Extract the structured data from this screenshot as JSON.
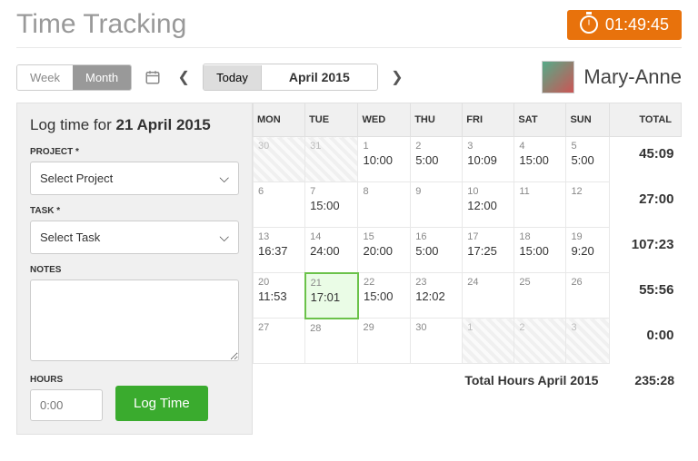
{
  "page_title": "Time Tracking",
  "timer": "01:49:45",
  "view_toggle": {
    "week": "Week",
    "month": "Month",
    "active": "month"
  },
  "today_label": "Today",
  "current_period": "April 2015",
  "user": {
    "name": "Mary-Anne"
  },
  "sidebar": {
    "title_prefix": "Log time for ",
    "title_date": "21 April 2015",
    "project_label": "PROJECT *",
    "project_placeholder": "Select Project",
    "task_label": "TASK *",
    "task_placeholder": "Select Task",
    "notes_label": "NOTES",
    "hours_label": "HOURS",
    "hours_placeholder": "0:00",
    "log_button": "Log Time"
  },
  "calendar": {
    "day_headers": [
      "MON",
      "TUE",
      "WED",
      "THU",
      "FRI",
      "SAT",
      "SUN",
      "TOTAL"
    ],
    "weeks": [
      {
        "days": [
          {
            "num": "30",
            "hours": "",
            "out": true
          },
          {
            "num": "31",
            "hours": "",
            "out": true
          },
          {
            "num": "1",
            "hours": "10:00"
          },
          {
            "num": "2",
            "hours": "5:00"
          },
          {
            "num": "3",
            "hours": "10:09"
          },
          {
            "num": "4",
            "hours": "15:00"
          },
          {
            "num": "5",
            "hours": "5:00"
          }
        ],
        "total": "45:09"
      },
      {
        "days": [
          {
            "num": "6",
            "hours": ""
          },
          {
            "num": "7",
            "hours": "15:00"
          },
          {
            "num": "8",
            "hours": ""
          },
          {
            "num": "9",
            "hours": ""
          },
          {
            "num": "10",
            "hours": "12:00"
          },
          {
            "num": "11",
            "hours": ""
          },
          {
            "num": "12",
            "hours": ""
          }
        ],
        "total": "27:00"
      },
      {
        "days": [
          {
            "num": "13",
            "hours": "16:37"
          },
          {
            "num": "14",
            "hours": "24:00"
          },
          {
            "num": "15",
            "hours": "20:00"
          },
          {
            "num": "16",
            "hours": "5:00"
          },
          {
            "num": "17",
            "hours": "17:25"
          },
          {
            "num": "18",
            "hours": "15:00"
          },
          {
            "num": "19",
            "hours": "9:20"
          }
        ],
        "total": "107:23"
      },
      {
        "days": [
          {
            "num": "20",
            "hours": "11:53"
          },
          {
            "num": "21",
            "hours": "17:01",
            "selected": true
          },
          {
            "num": "22",
            "hours": "15:00"
          },
          {
            "num": "23",
            "hours": "12:02"
          },
          {
            "num": "24",
            "hours": ""
          },
          {
            "num": "25",
            "hours": ""
          },
          {
            "num": "26",
            "hours": ""
          }
        ],
        "total": "55:56"
      },
      {
        "days": [
          {
            "num": "27",
            "hours": ""
          },
          {
            "num": "28",
            "hours": ""
          },
          {
            "num": "29",
            "hours": ""
          },
          {
            "num": "30",
            "hours": ""
          },
          {
            "num": "1",
            "hours": "",
            "out": true
          },
          {
            "num": "2",
            "hours": "",
            "out": true
          },
          {
            "num": "3",
            "hours": "",
            "out": true
          }
        ],
        "total": "0:00"
      }
    ],
    "footer_label": "Total Hours April 2015",
    "footer_total": "235:28"
  }
}
